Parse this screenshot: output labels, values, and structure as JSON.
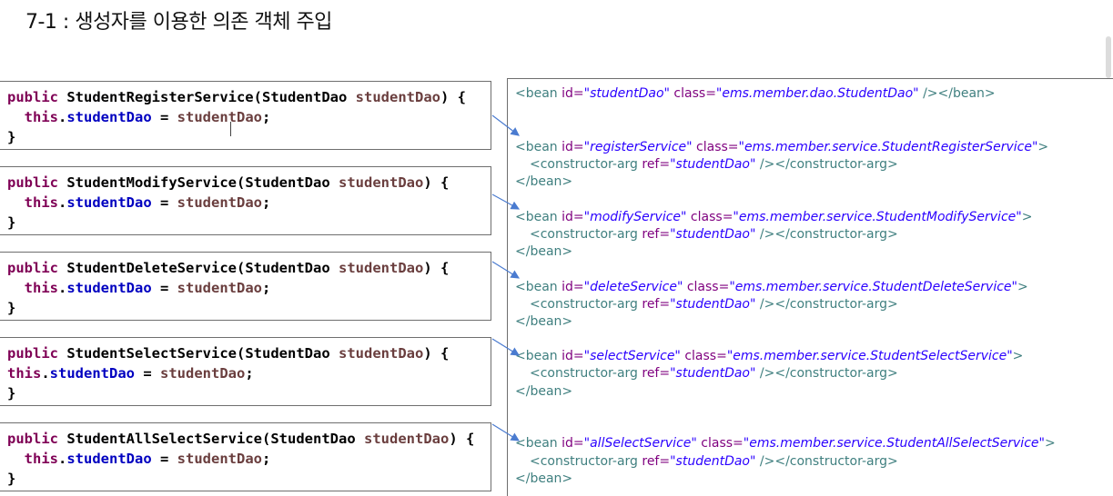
{
  "title": "7-1 : 생성자를 이용한 의존 객체 주입",
  "java_blocks": [
    {
      "kw": "public",
      "ctor": "StudentRegisterService",
      "ptype": "StudentDao",
      "pname": "studentDao",
      "this": "this",
      "dot": ".",
      "field": "studentDao",
      "assign": " = ",
      "rhs": "studentDao",
      "end": ";",
      "open": ") {",
      "close": "}"
    },
    {
      "kw": "public",
      "ctor": "StudentModifyService",
      "ptype": "StudentDao",
      "pname": "studentDao",
      "this": "this",
      "dot": ".",
      "field": "studentDao",
      "assign": " = ",
      "rhs": "studentDao",
      "end": ";",
      "open": ") {",
      "close": "}"
    },
    {
      "kw": "public",
      "ctor": "StudentDeleteService",
      "ptype": "StudentDao",
      "pname": "studentDao",
      "this": "this",
      "dot": ".",
      "field": "studentDao",
      "assign": " = ",
      "rhs": "studentDao",
      "end": ";",
      "open": ") {",
      "close": "}"
    },
    {
      "kw": "public",
      "ctor": "StudentSelectService",
      "ptype": "StudentDao",
      "pname": "studentDao",
      "this": "this",
      "dot": ".",
      "field": "studentDao",
      "assign": " = ",
      "rhs": "studentDao",
      "end": ";",
      "open": ") {",
      "close": "}"
    },
    {
      "kw": "public",
      "ctor": "StudentAllSelectService",
      "ptype": "StudentDao",
      "pname": "studentDao",
      "this": "this",
      "dot": ".",
      "field": "studentDao",
      "assign": " = ",
      "rhs": "studentDao",
      "end": ";",
      "open": ") {",
      "close": "}"
    }
  ],
  "xml": {
    "dao_bean": {
      "open": "<bean ",
      "id_attr": "id=",
      "id_val": "\"studentDao\"",
      "class_attr": " class=",
      "class_val": "\"ems.member.dao.StudentDao\"",
      "close": " /></bean>"
    },
    "beans": [
      {
        "id": "\"registerService\"",
        "cls": "\"ems.member.service.StudentRegisterService\""
      },
      {
        "id": "\"modifyService\"",
        "cls": "\"ems.member.service.StudentModifyService\""
      },
      {
        "id": "\"deleteService\"",
        "cls": "\"ems.member.service.StudentDeleteService\""
      },
      {
        "id": "\"selectService\"",
        "cls": "\"ems.member.service.StudentSelectService\""
      },
      {
        "id": "\"allSelectService\"",
        "cls": "\"ems.member.service.StudentAllSelectService\""
      }
    ],
    "bean_open": "<bean ",
    "id_attr": "id=",
    "class_attr": " class=",
    "gt": ">",
    "ctor_arg_open": "<constructor-arg ",
    "ref_attr": "ref=",
    "ref_val": "\"studentDao\"",
    "ctor_arg_close": " /></constructor-arg>",
    "bean_close": "</bean>"
  }
}
